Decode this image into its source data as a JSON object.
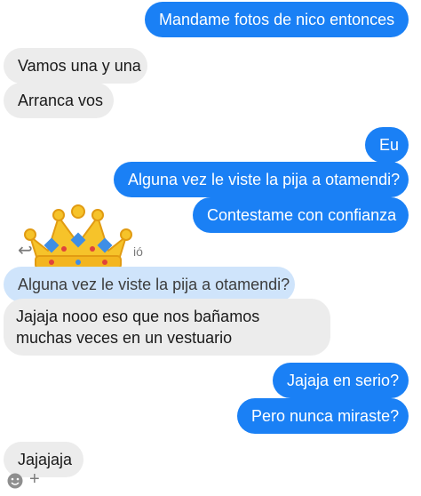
{
  "messages": [
    {
      "text": "Mandame fotos de nico entonces"
    },
    {
      "text": "Vamos una y una"
    },
    {
      "text": "Arranca vos"
    },
    {
      "text": "Eu"
    },
    {
      "text": "Alguna vez le viste la pija a otamendi?"
    },
    {
      "text": "Contestame con confianza"
    },
    {
      "text": "Alguna vez le viste la pija a otamendi?"
    },
    {
      "text": "Jajaja nooo eso que nos bañamos muchas veces en un vestuario"
    },
    {
      "text": "Jajaja en serio?"
    },
    {
      "text": "Pero nunca miraste?"
    },
    {
      "text": "Jajajaja"
    }
  ],
  "reply_indicator": {
    "text": "ió",
    "icon": "reply-arrow-icon"
  },
  "sticker": {
    "icon": "crown-icon"
  },
  "footer": {
    "icons": [
      "smiley-icon",
      "plus-icon"
    ]
  },
  "colors": {
    "outgoing_bubble": "#1a80f5",
    "incoming_bubble": "#ececec",
    "quoted_bubble": "#cfe4fb"
  }
}
